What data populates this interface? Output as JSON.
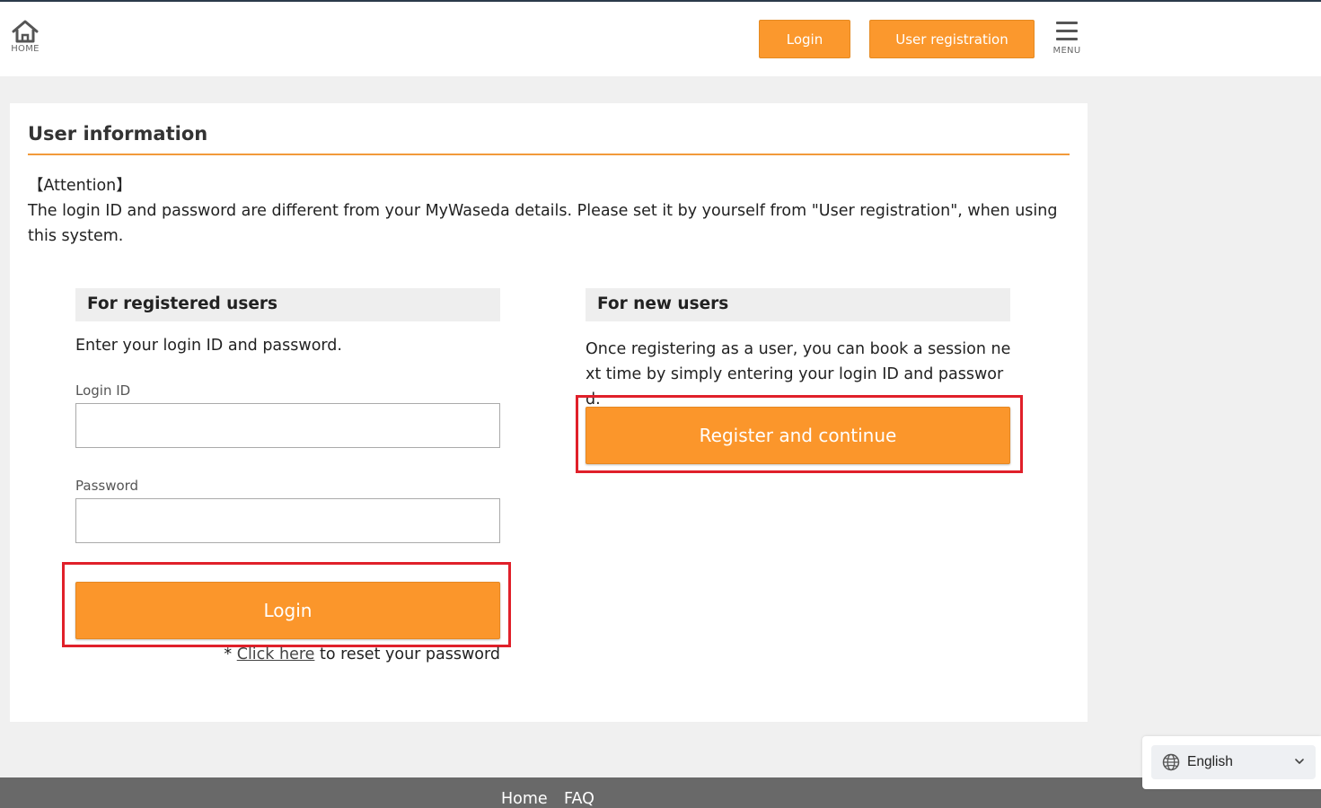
{
  "header": {
    "home_label": "HOME",
    "login_label": "Login",
    "register_label": "User registration",
    "menu_label": "MENU"
  },
  "card": {
    "title": "User information",
    "attention_heading": "【Attention】",
    "attention_text": "The login ID and password are different from your MyWaseda details. Please set it by yourself from \"User registration\", when using this system."
  },
  "registered": {
    "heading": "For registered users",
    "description": "Enter your login ID and password.",
    "login_id_label": "Login ID",
    "login_id_value": "",
    "password_label": "Password",
    "password_value": "",
    "login_button": "Login",
    "reset_prefix": "* ",
    "reset_link": "Click here",
    "reset_suffix": " to reset your password"
  },
  "newusers": {
    "heading": "For new users",
    "description": "Once registering as a user, you can book a session next time by simply entering your login ID and password.",
    "register_button": "Register and continue"
  },
  "footer": {
    "home": "Home",
    "faq": "FAQ"
  },
  "language": {
    "selected": "English"
  },
  "colors": {
    "accent_orange": "#fb982d",
    "highlight_red": "#e0202a",
    "rule_orange": "#f29a3a",
    "footer_gray": "#696969"
  },
  "icons": [
    "home-icon",
    "menu-icon",
    "globe-icon",
    "chevron-down-icon"
  ]
}
